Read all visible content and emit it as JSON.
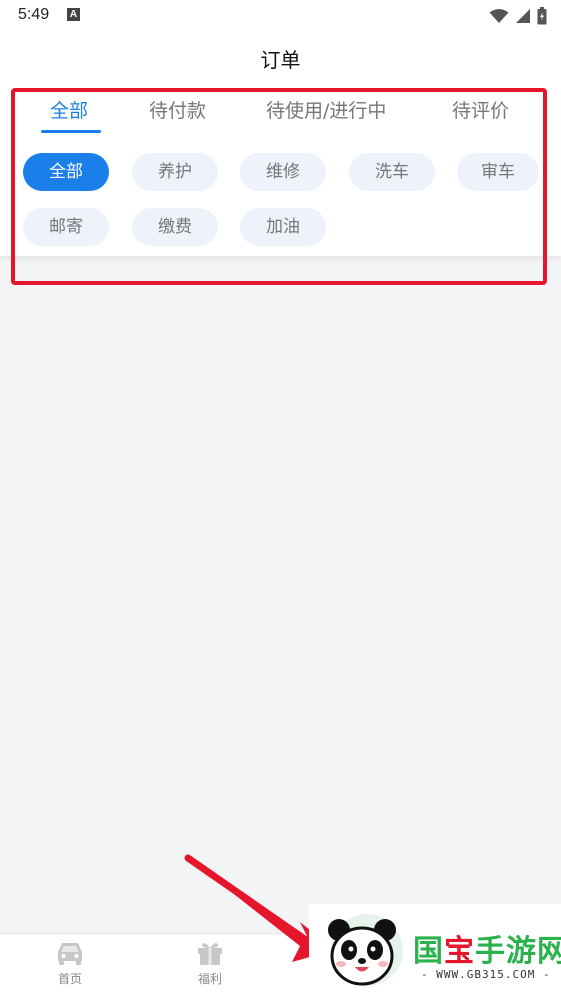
{
  "status_bar": {
    "time": "5:49",
    "notification_letter": "A",
    "icons": [
      "wifi-icon",
      "signal-icon",
      "battery-icon"
    ]
  },
  "header": {
    "title": "订单"
  },
  "tabs": [
    {
      "label": "全部",
      "active": true
    },
    {
      "label": "待付款",
      "active": false
    },
    {
      "label": "待使用/进行中",
      "active": false
    },
    {
      "label": "待评价",
      "active": false
    }
  ],
  "filters": [
    {
      "label": "全部",
      "active": true
    },
    {
      "label": "养护",
      "active": false
    },
    {
      "label": "维修",
      "active": false
    },
    {
      "label": "洗车",
      "active": false
    },
    {
      "label": "审车",
      "active": false
    },
    {
      "label": "邮寄",
      "active": false
    },
    {
      "label": "缴费",
      "active": false
    },
    {
      "label": "加油",
      "active": false
    }
  ],
  "bottom_nav": [
    {
      "label": "首页",
      "icon": "car-icon"
    },
    {
      "label": "福利",
      "icon": "gift-icon"
    }
  ],
  "watermark": {
    "logo_text": "国宝手游网",
    "url_text": "- WWW.GB315.COM -"
  },
  "colors": {
    "accent": "#1a7fe8",
    "highlight": "#e5162b",
    "chip_bg": "#eef2fb",
    "page_bg": "#f3f4f6"
  }
}
